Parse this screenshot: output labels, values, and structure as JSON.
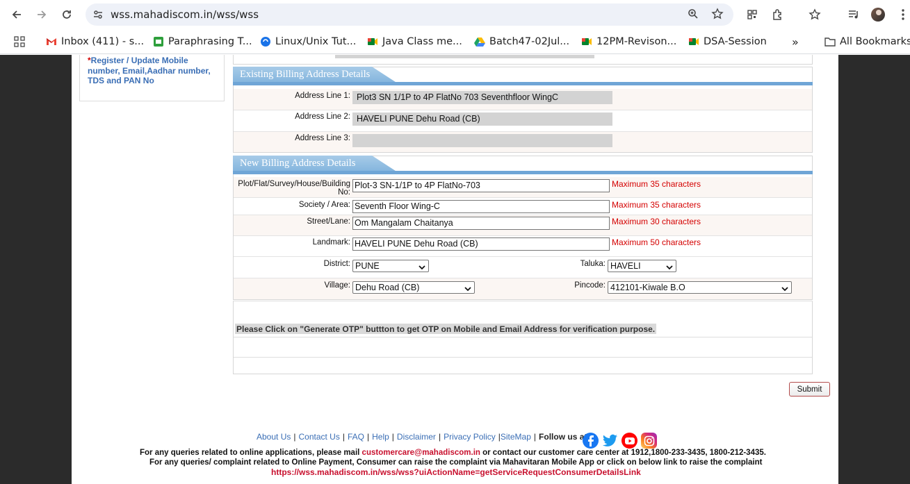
{
  "browser": {
    "url": "wss.mahadiscom.in/wss/wss",
    "bookmarks": [
      {
        "label": "Inbox (411) - s...",
        "icon": "gmail-icon"
      },
      {
        "label": "Paraphrasing T...",
        "icon": "green-app-icon"
      },
      {
        "label": "Linux/Unix Tut...",
        "icon": "globe-icon"
      },
      {
        "label": "Java Class me...",
        "icon": "meet-icon"
      },
      {
        "label": "Batch47-02Jul...",
        "icon": "drive-icon"
      },
      {
        "label": "12PM-Revison...",
        "icon": "meet-icon"
      },
      {
        "label": "DSA-Session",
        "icon": "meet-icon"
      }
    ],
    "more": "»",
    "all_bookmarks": "All Bookmarks"
  },
  "sidebar": {
    "required_mark": "*",
    "link_label": "Register / Update Mobile number, Email,Aadhar number, TDS and PAN No"
  },
  "existing": {
    "title": "Existing Billing Address Details",
    "rows": [
      {
        "label": "Address Line 1:",
        "value": "Plot3 SN 1/1P to 4P FlatNo 703 Seventhfloor WingC"
      },
      {
        "label": "Address Line 2:",
        "value": "HAVELI PUNE Dehu Road (CB)"
      },
      {
        "label": "Address Line 3:",
        "value": ""
      }
    ]
  },
  "new_address": {
    "title": "New Billing Address Details",
    "plot_label": "Plot/Flat/Survey/House/Building No:",
    "plot_value": "Plot-3 SN-1/1P to 4P FlatNo-703",
    "plot_hint": "Maximum 35 characters",
    "society_label": "Society / Area:",
    "society_value": "Seventh Floor Wing-C",
    "society_hint": "Maximum 35 characters",
    "street_label": "Street/Lane:",
    "street_value": "Om Mangalam Chaitanya",
    "street_hint": "Maximum 30 characters",
    "landmark_label": "Landmark:",
    "landmark_value": "HAVELI PUNE Dehu Road (CB)",
    "landmark_hint": "Maximum 50 characters",
    "district_label": "District:",
    "district_value": "PUNE",
    "taluka_label": "Taluka:",
    "taluka_value": "HAVELI",
    "village_label": "Village:",
    "village_value": "Dehu Road (CB)",
    "pincode_label": "Pincode:",
    "pincode_value": "412101-Kiwale B.O"
  },
  "otp_message": "Please Click on \"Generate OTP\" buttton to get OTP on Mobile and Email Address for verification purpose.",
  "submit_label": "Submit",
  "footer": {
    "links": [
      "About Us",
      "Contact Us",
      "FAQ",
      "Help",
      "Disclaimer",
      "Privacy Policy",
      "SiteMap"
    ],
    "follow": "Follow us at:",
    "line1_prefix": "For any queries related to online applications, please mail ",
    "email": "customercare@mahadiscom.in",
    "line1_suffix": " or contact our customer care center at 1912,1800-233-3435, 1800-212-3435.",
    "line2": "For any queries/ complaint related to Online Payment, Consumer can raise the complaint via Mahavitaran Mobile App or click on below link to raise the complaint",
    "complaint_link": "https://wss.mahadiscom.in/wss/wss?uiActionName=getServiceRequestConsumerDetailsLink"
  },
  "colors": {
    "link": "#3a6eb5",
    "error": "#d40000",
    "panel_header": "#6fa5d6",
    "facebook": "#1877f2",
    "twitter": "#1d9bf0",
    "youtube": "#ff0000",
    "instagram": "#d62976"
  }
}
